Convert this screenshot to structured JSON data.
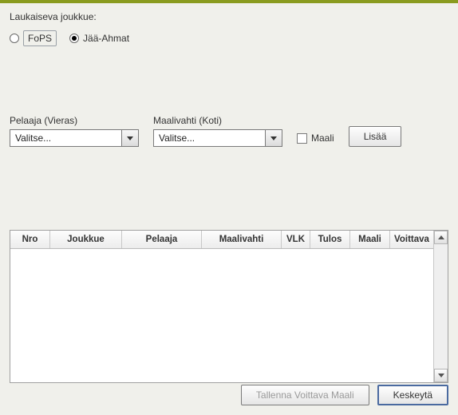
{
  "shooting_team": {
    "label": "Laukaiseva joukkue:",
    "options": [
      {
        "label": "FoPS"
      },
      {
        "label": "Jää-Ahmat"
      }
    ]
  },
  "player": {
    "label": "Pelaaja (Vieras)",
    "value": "Valitse..."
  },
  "goalie": {
    "label": "Maalivahti (Koti)",
    "value": "Valitse..."
  },
  "goal_checkbox": {
    "label": "Maali"
  },
  "add_button": {
    "label": "Lisää"
  },
  "columns": {
    "nro": "Nro",
    "joukkue": "Joukkue",
    "pelaaja": "Pelaaja",
    "maalivahti": "Maalivahti",
    "vlk": "VLK",
    "tulos": "Tulos",
    "maali": "Maali",
    "voittava": "Voittava"
  },
  "footer": {
    "save": "Tallenna Voittava Maali",
    "cancel": "Keskeytä"
  }
}
